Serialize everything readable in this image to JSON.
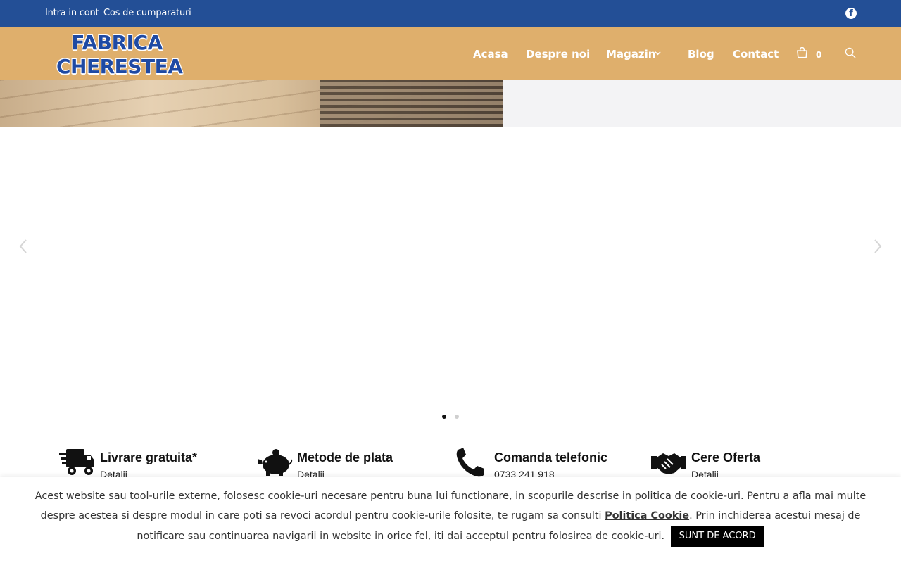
{
  "topbar": {
    "account_link": "Intra in cont",
    "cart_link": "Cos de cumparaturi",
    "social_icon": "facebook-icon",
    "bg_color": "#234f96"
  },
  "header": {
    "logo_line1": "FABRICA",
    "logo_line2": "CHERESTEA",
    "nav": [
      "Acasa",
      "Despre noi",
      "Magazin",
      "Blog",
      "Contact"
    ],
    "cart_count": "0",
    "bg_color": "#dfaf6c"
  },
  "slider": {
    "active_dot": 1,
    "dot_count": 2
  },
  "features": [
    {
      "icon": "delivery-truck-icon",
      "title": "Livrare gratuita*",
      "sub": "Detalii"
    },
    {
      "icon": "piggy-bank-icon",
      "title": "Metode de plata",
      "sub": "Detalii"
    },
    {
      "icon": "phone-icon",
      "title": "Comanda telefonic",
      "sub": "0733 241 918"
    },
    {
      "icon": "handshake-icon",
      "title": "Cere Oferta",
      "sub": "Detalii"
    }
  ],
  "cookie": {
    "text_before": "Acest website sau tool-urile externe, folosesc cookie-uri necesare pentru buna lui functionare, in scopurile descrise in politica de cookie-uri. Pentru a afla mai multe despre acestea si despre modul in care poti sa revoci acordul pentru cookie-urile folosite, te rugam sa consulti ",
    "link": "Politica Cookie",
    "text_after": ". Prin inchiderea acestui mesaj de notificare sau continuarea navigarii in website in orice fel, iti dai acceptul pentru folosirea de cookie-uri.",
    "accept_button": "SUNT DE ACORD"
  }
}
